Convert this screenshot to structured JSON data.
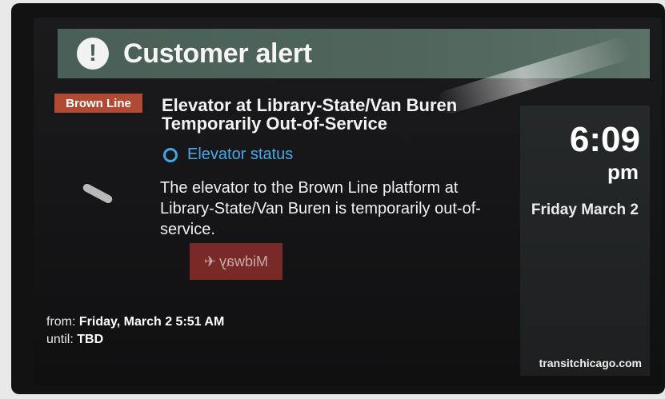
{
  "header": {
    "title": "Customer alert",
    "icon": "exclamation-icon"
  },
  "line": {
    "label": "Brown Line",
    "color": "#b14a33"
  },
  "alert": {
    "heading": "Elevator at Library-State/Van Buren Temporarily Out-of-Service",
    "status_link": "Elevator status",
    "description": "The elevator to the Brown Line platform at Library-State/Van Buren is temporarily out-of-service."
  },
  "sign": {
    "text": "Midway"
  },
  "schedule": {
    "from_label": "from:",
    "from_value": "Friday, March 2 5:51 AM",
    "until_label": "until:",
    "until_value": "TBD"
  },
  "clock": {
    "time": "6:09",
    "ampm": "pm",
    "date": "Friday March 2"
  },
  "footer": {
    "website": "transitchicago.com"
  }
}
